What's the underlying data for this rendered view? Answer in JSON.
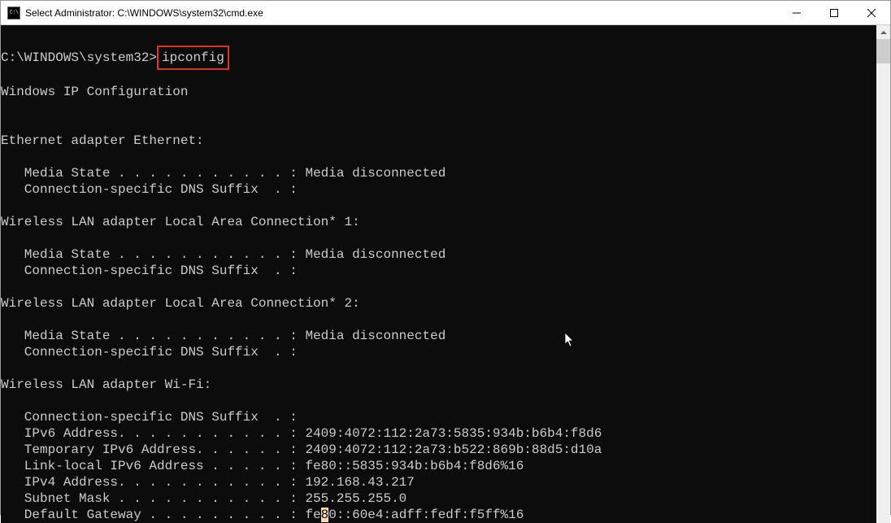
{
  "titlebar": {
    "icon_label": "C:\\",
    "title": "Select Administrator: C:\\WINDOWS\\system32\\cmd.exe"
  },
  "terminal": {
    "prompt": "C:\\WINDOWS\\system32>",
    "command": "ipconfig",
    "header": "Windows IP Configuration",
    "adapters": [
      {
        "name": "Ethernet adapter Ethernet:",
        "lines": [
          "   Media State . . . . . . . . . . . : Media disconnected",
          "   Connection-specific DNS Suffix  . :"
        ]
      },
      {
        "name": "Wireless LAN adapter Local Area Connection* 1:",
        "lines": [
          "   Media State . . . . . . . . . . . : Media disconnected",
          "   Connection-specific DNS Suffix  . :"
        ]
      },
      {
        "name": "Wireless LAN adapter Local Area Connection* 2:",
        "lines": [
          "   Media State . . . . . . . . . . . : Media disconnected",
          "   Connection-specific DNS Suffix  . :"
        ]
      },
      {
        "name": "Wireless LAN adapter Wi-Fi:",
        "lines": [
          "   Connection-specific DNS Suffix  . :",
          "   IPv6 Address. . . . . . . . . . . : 2409:4072:112:2a73:5835:934b:b6b4:f8d6",
          "   Temporary IPv6 Address. . . . . . : 2409:4072:112:2a73:b522:869b:88d5:d10a",
          "   Link-local IPv6 Address . . . . . : fe80::5835:934b:b6b4:f8d6%16",
          "   IPv4 Address. . . . . . . . . . . : 192.168.43.217",
          "   Subnet Mask . . . . . . . . . . . : 255.255.255.0"
        ],
        "gateway_prefix": "   Default Gateway . . . . . . . . . : fe",
        "gateway_selected": "8",
        "gateway_suffix": "0::60e4:adff:fedf:f5ff%16"
      }
    ]
  }
}
